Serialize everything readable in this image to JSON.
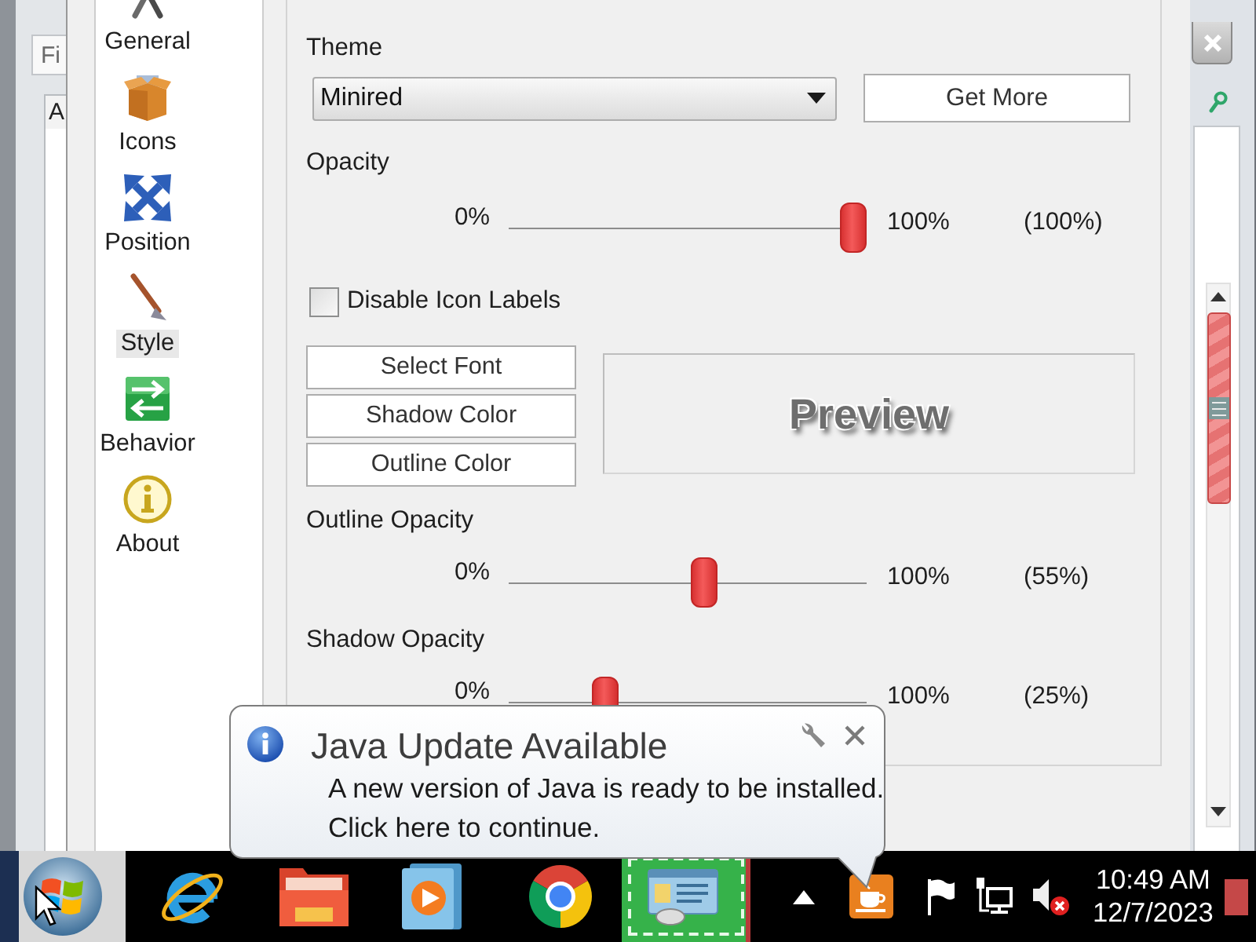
{
  "left_window": {
    "search_field": {
      "placeholder": "Fi"
    },
    "tab": "A"
  },
  "dialog": {
    "sidebar": {
      "items": [
        {
          "label": "General",
          "selected": false
        },
        {
          "label": "Icons",
          "selected": false
        },
        {
          "label": "Position",
          "selected": false
        },
        {
          "label": "Style",
          "selected": true
        },
        {
          "label": "Behavior",
          "selected": false
        },
        {
          "label": "About",
          "selected": false
        }
      ]
    },
    "settings": {
      "theme": {
        "label": "Theme",
        "value": "Minired"
      },
      "get_more_button": "Get More",
      "opacity": {
        "label": "Opacity",
        "min": "0%",
        "max": "100%",
        "reading": "(100%)",
        "level": 1
      },
      "disable_icon_labels": {
        "label": "Disable Icon Labels",
        "checked": false
      },
      "buttons": [
        "Select Font",
        "Shadow Color",
        "Outline Color"
      ],
      "preview": "Preview",
      "outline_opacity": {
        "label": "Outline Opacity",
        "min": "0%",
        "max": "100%",
        "reading": "(55%)",
        "level": 0.55
      },
      "shadow_opacity": {
        "label": "Shadow Opacity",
        "min": "0%",
        "max": "100%",
        "reading": "(25%)",
        "level": 0.25
      }
    }
  },
  "notification": {
    "title": "Java Update Available",
    "message": "A new version of Java is ready to be installed. Click here to continue."
  },
  "taskbar": {
    "clock": {
      "time": "10:49 AM",
      "date": "12/7/2023"
    }
  }
}
